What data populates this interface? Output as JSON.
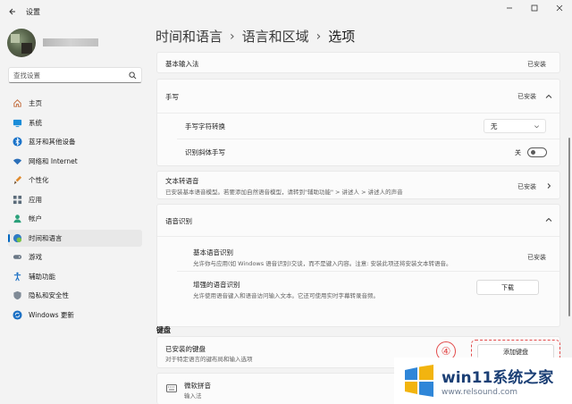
{
  "window": {
    "title": "设置"
  },
  "profile": {},
  "search": {
    "placeholder": "查找设置"
  },
  "nav": [
    {
      "label": "主页",
      "icon": "home-icon",
      "active": false
    },
    {
      "label": "系统",
      "icon": "monitor-icon",
      "active": false
    },
    {
      "label": "蓝牙和其他设备",
      "icon": "bluetooth-icon",
      "active": false
    },
    {
      "label": "网络和 Internet",
      "icon": "wifi-icon",
      "active": false
    },
    {
      "label": "个性化",
      "icon": "brush-icon",
      "active": false
    },
    {
      "label": "应用",
      "icon": "apps-icon",
      "active": false
    },
    {
      "label": "帐户",
      "icon": "person-icon",
      "active": false
    },
    {
      "label": "时间和语言",
      "icon": "globe-clock-icon",
      "active": true
    },
    {
      "label": "游戏",
      "icon": "gamepad-icon",
      "active": false
    },
    {
      "label": "辅助功能",
      "icon": "accessibility-icon",
      "active": false
    },
    {
      "label": "隐私和安全性",
      "icon": "shield-icon",
      "active": false
    },
    {
      "label": "Windows 更新",
      "icon": "update-icon",
      "active": false
    }
  ],
  "breadcrumb": {
    "level1": "时间和语言",
    "level2": "语言和区域",
    "current": "选项"
  },
  "basic_input": {
    "title": "基本输入法",
    "status": "已安装"
  },
  "handwriting": {
    "title": "手写",
    "status": "已安装",
    "conversion_label": "手写字符转换",
    "conversion_value": "无",
    "italic_label": "识别斜体手写",
    "italic_state": "关"
  },
  "tts": {
    "title": "文本转语音",
    "desc": "已安装基本语音模型。若要添加自然语音模型，请转到\"辅助功能\" > 讲述人 > 讲述人的声音",
    "status": "已安装"
  },
  "speech": {
    "title": "语音识别",
    "basic_title": "基本语音识别",
    "basic_desc": "允许你与应用(如 Windows 语音识别)交谈，而不是键入内容。注意: 安装此项还将安装文本转语音。",
    "basic_status": "已安装",
    "enhanced_title": "增强的语音识别",
    "enhanced_desc": "允许使用语音键入和语音访问输入文本。它还可使用实时字幕转录音频。",
    "download_label": "下载"
  },
  "keyboard": {
    "section": "键盘",
    "installed_title": "已安装的键盘",
    "installed_desc": "对于特定语言的键布局和输入选项",
    "add_label": "添加键盘",
    "annotation": "④",
    "item_name": "微软拼音",
    "item_type": "输入法"
  },
  "watermark": {
    "title": "win11系统之家",
    "url": "www.relsound.com"
  },
  "colors": {
    "accent": "#0067c0",
    "annotation": "#e34b4b"
  }
}
